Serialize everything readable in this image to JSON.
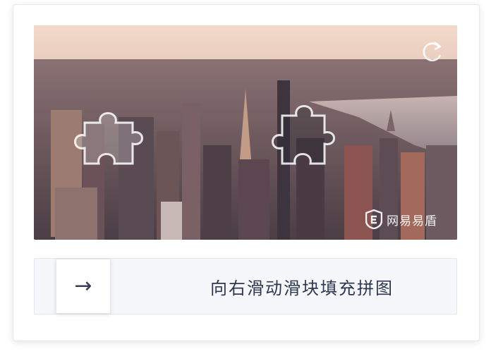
{
  "captcha": {
    "slider_hint": "向右滑动滑块填充拼图",
    "arrow_glyph": "→",
    "brand": "网易易盾"
  },
  "icons": {
    "refresh": "refresh-icon",
    "arrow": "arrow-right-icon",
    "logo": "brand-logo-icon"
  },
  "colors": {
    "track_bg": "#f6f7fb",
    "hint_text": "#2f3650",
    "sky": "#e8d2c8"
  }
}
